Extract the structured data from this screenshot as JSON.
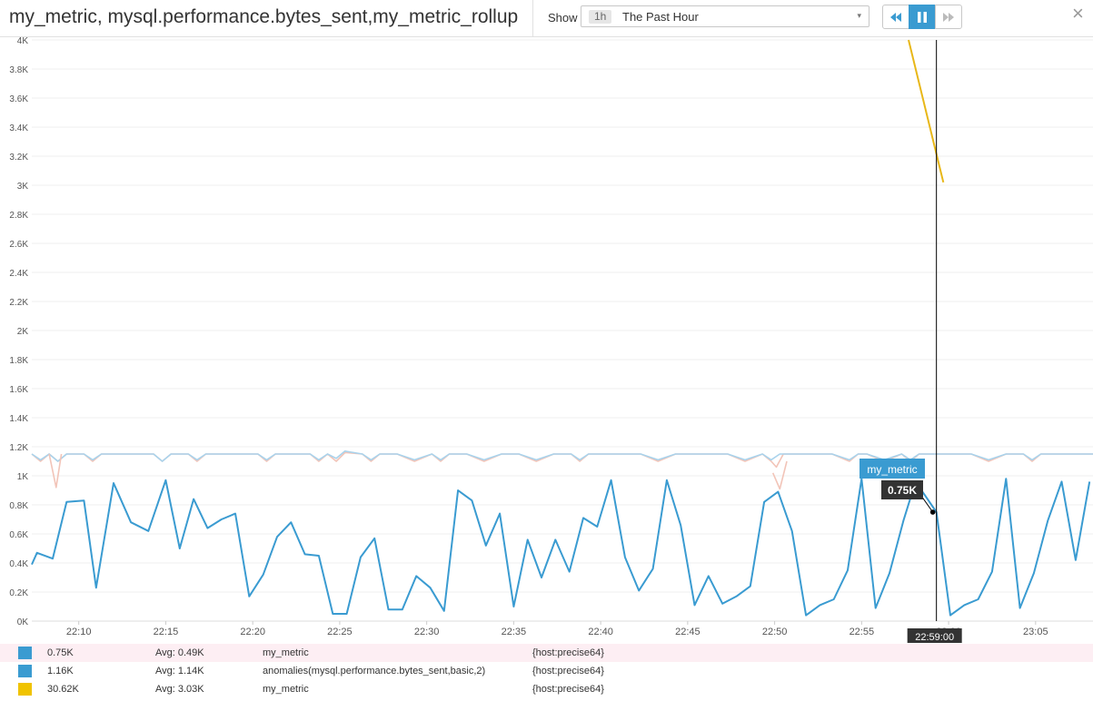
{
  "header": {
    "title": "my_metric, mysql.performance.bytes_sent,my_metric_rollup",
    "show_label": "Show",
    "timeframe_badge": "1h",
    "timeframe_value": "The Past Hour",
    "buttons": {
      "rewind_icon": "double-chevron-left-icon",
      "pause_icon": "pause-icon",
      "forward_icon": "double-chevron-right-icon"
    },
    "close_label": "×"
  },
  "tooltip": {
    "series_name": "my_metric",
    "value": "0.75K",
    "time": "22:59:00"
  },
  "legend": [
    {
      "color": "#3a9bd1",
      "current": "0.75K",
      "avg": "Avg: 0.49K",
      "name": "my_metric",
      "tags": "{host:precise64}",
      "highlighted": true
    },
    {
      "color": "#3a9bd1",
      "current": "1.16K",
      "avg": "Avg: 1.14K",
      "name": "anomalies(mysql.performance.bytes_sent,basic,2)",
      "tags": "{host:precise64}",
      "highlighted": false
    },
    {
      "color": "#f0c300",
      "current": "30.62K",
      "avg": "Avg: 3.03K",
      "name": "my_metric",
      "tags": "{host:precise64}",
      "highlighted": false
    }
  ],
  "chart_data": {
    "type": "line",
    "x_unit": "minutes",
    "x_range": [
      "22:07:00",
      "23:07:00"
    ],
    "xlim": [
      22.3,
      83.3
    ],
    "ylim": [
      0,
      4000
    ],
    "grid": true,
    "y_ticks": [
      {
        "v": 0,
        "label": "0K"
      },
      {
        "v": 200,
        "label": "0.2K"
      },
      {
        "v": 400,
        "label": "0.4K"
      },
      {
        "v": 600,
        "label": "0.6K"
      },
      {
        "v": 800,
        "label": "0.8K"
      },
      {
        "v": 1000,
        "label": "1K"
      },
      {
        "v": 1200,
        "label": "1.2K"
      },
      {
        "v": 1400,
        "label": "1.4K"
      },
      {
        "v": 1600,
        "label": "1.6K"
      },
      {
        "v": 1800,
        "label": "1.8K"
      },
      {
        "v": 2000,
        "label": "2K"
      },
      {
        "v": 2200,
        "label": "2.2K"
      },
      {
        "v": 2400,
        "label": "2.4K"
      },
      {
        "v": 2600,
        "label": "2.6K"
      },
      {
        "v": 2800,
        "label": "2.8K"
      },
      {
        "v": 3000,
        "label": "3K"
      },
      {
        "v": 3200,
        "label": "3.2K"
      },
      {
        "v": 3400,
        "label": "3.4K"
      },
      {
        "v": 3600,
        "label": "3.6K"
      },
      {
        "v": 3800,
        "label": "3.8K"
      },
      {
        "v": 4000,
        "label": "4K"
      }
    ],
    "x_ticks": [
      {
        "v": 25,
        "label": "22:10"
      },
      {
        "v": 30,
        "label": "22:15"
      },
      {
        "v": 35,
        "label": "22:20"
      },
      {
        "v": 40,
        "label": "22:25"
      },
      {
        "v": 45,
        "label": "22:30"
      },
      {
        "v": 50,
        "label": "22:35"
      },
      {
        "v": 55,
        "label": "22:40"
      },
      {
        "v": 60,
        "label": "22:45"
      },
      {
        "v": 65,
        "label": "22:50"
      },
      {
        "v": 70,
        "label": "22:55"
      },
      {
        "v": 75,
        "label": "23:00"
      },
      {
        "v": 80,
        "label": "23:05"
      }
    ],
    "cursor_x": 74.3,
    "series": [
      {
        "name": "anomalies(mysql.performance.bytes_sent,basic,2)",
        "color": "#f2c4b8",
        "style": "band_lower",
        "x": [
          22.3,
          22.8,
          23.3,
          23.8,
          24.3,
          25.3,
          25.8,
          26.3,
          27.3,
          28.3,
          29.3,
          29.8,
          30.3,
          31.3,
          31.8,
          32.3,
          33.3,
          34.3,
          35.3,
          35.8,
          36.3,
          37.3,
          38.3,
          38.8,
          39.3,
          39.8,
          40.3,
          41.3,
          41.8,
          42.3,
          43.3,
          44.3,
          45.3,
          45.8,
          46.3,
          47.3,
          48.3,
          49.3,
          50.3,
          51.3,
          52.3,
          53.3,
          53.8,
          54.3,
          55.3,
          56.3,
          57.3,
          58.3,
          59.3,
          60.3,
          61.3,
          62.3,
          63.3,
          64.3,
          64.8,
          65.1,
          65.5,
          66.3,
          67.3,
          68.3,
          69.3,
          69.8,
          70.3,
          71.3,
          72.3,
          72.8,
          73.3,
          74.3,
          75.3,
          76.3,
          77.3,
          78.3,
          79.3,
          79.8,
          80.3,
          81.3,
          82.3,
          83.3
        ],
        "values": [
          1150,
          1100,
          1150,
          1100,
          1150,
          1150,
          1100,
          1150,
          1150,
          1150,
          1150,
          1100,
          1150,
          1150,
          1100,
          1150,
          1150,
          1150,
          1150,
          1100,
          1150,
          1150,
          1150,
          1100,
          1150,
          1100,
          1160,
          1150,
          1100,
          1150,
          1150,
          1100,
          1150,
          1100,
          1150,
          1150,
          1100,
          1150,
          1150,
          1100,
          1150,
          1150,
          1100,
          1150,
          1150,
          1150,
          1150,
          1100,
          1150,
          1150,
          1150,
          1150,
          1100,
          1150,
          1100,
          1060,
          1150,
          1150,
          1150,
          1150,
          1100,
          1150,
          1150,
          1100,
          1150,
          1100,
          1150,
          1150,
          1150,
          1150,
          1100,
          1150,
          1150,
          1100,
          1150,
          1150,
          1150,
          1150
        ]
      },
      {
        "name": "anomalies(mysql.performance.bytes_sent,basic,2)",
        "color": "#a9d3ec",
        "style": "band_upper",
        "x": [
          22.3,
          22.8,
          23.3,
          23.8,
          24.3,
          25.3,
          25.8,
          26.3,
          27.3,
          28.3,
          29.3,
          29.8,
          30.3,
          31.3,
          31.8,
          32.3,
          33.3,
          34.3,
          35.3,
          35.8,
          36.3,
          37.3,
          38.3,
          38.8,
          39.3,
          39.8,
          40.3,
          41.3,
          41.8,
          42.3,
          43.3,
          44.3,
          45.3,
          45.8,
          46.3,
          47.3,
          48.3,
          49.3,
          50.3,
          51.3,
          52.3,
          53.3,
          53.8,
          54.3,
          55.3,
          56.3,
          57.3,
          58.3,
          59.3,
          60.3,
          61.3,
          62.3,
          63.3,
          64.3,
          64.8,
          65.3,
          66.3,
          67.3,
          68.3,
          69.3,
          69.8,
          70.3,
          71.3,
          72.3,
          72.8,
          73.3,
          74.3,
          75.3,
          76.3,
          77.3,
          78.3,
          79.3,
          79.8,
          80.3,
          81.3,
          82.3,
          83.3
        ],
        "values": [
          1150,
          1110,
          1150,
          1100,
          1150,
          1150,
          1110,
          1150,
          1150,
          1150,
          1150,
          1100,
          1150,
          1150,
          1110,
          1150,
          1150,
          1150,
          1150,
          1110,
          1150,
          1150,
          1150,
          1110,
          1150,
          1120,
          1170,
          1150,
          1110,
          1150,
          1150,
          1110,
          1150,
          1110,
          1150,
          1150,
          1110,
          1150,
          1150,
          1110,
          1150,
          1150,
          1110,
          1150,
          1150,
          1150,
          1150,
          1110,
          1150,
          1150,
          1150,
          1150,
          1110,
          1150,
          1110,
          1150,
          1150,
          1150,
          1150,
          1110,
          1150,
          1150,
          1110,
          1150,
          1110,
          1150,
          1150,
          1150,
          1150,
          1110,
          1150,
          1150,
          1110,
          1150,
          1150,
          1150,
          1150
        ]
      },
      {
        "name": "anomalies(mysql.performance.bytes_sent,basic,2)",
        "color": "#f2c4b8",
        "style": "band_dips",
        "x": [
          23.3,
          23.7,
          24.0
        ],
        "values": [
          1150,
          920,
          1150
        ]
      },
      {
        "name": "anomalies(mysql.performance.bytes_sent,basic,2)",
        "color": "#f2c4b8",
        "style": "band_dips",
        "x": [
          64.9,
          65.3,
          65.7
        ],
        "values": [
          1020,
          910,
          1100
        ]
      },
      {
        "name": "my_metric",
        "color": "#3a9bd1",
        "style": "main",
        "x": [
          22.3,
          22.6,
          23.5,
          24.3,
          25.3,
          26.0,
          27.0,
          28.0,
          29.0,
          30.0,
          30.8,
          31.6,
          32.4,
          33.2,
          34.0,
          34.8,
          35.6,
          36.4,
          37.2,
          38.0,
          38.8,
          39.6,
          40.4,
          41.2,
          42.0,
          42.8,
          43.6,
          44.4,
          45.2,
          46.0,
          46.8,
          47.6,
          48.4,
          49.2,
          50.0,
          50.8,
          51.6,
          52.4,
          53.2,
          54.0,
          54.8,
          55.6,
          56.4,
          57.2,
          58.0,
          58.8,
          59.6,
          60.4,
          61.2,
          62.0,
          62.8,
          63.6,
          64.4,
          65.2,
          66.0,
          66.8,
          67.6,
          68.4,
          69.2,
          70.0,
          70.8,
          71.6,
          72.4,
          73.1,
          74.3,
          75.1,
          75.9,
          76.7,
          77.5,
          78.3,
          79.1,
          79.9,
          80.7,
          81.5,
          82.3,
          83.1
        ],
        "values": [
          390,
          470,
          430,
          820,
          830,
          230,
          950,
          680,
          620,
          970,
          500,
          840,
          640,
          700,
          740,
          170,
          320,
          580,
          680,
          460,
          450,
          50,
          50,
          440,
          570,
          80,
          80,
          310,
          230,
          70,
          900,
          830,
          520,
          740,
          100,
          560,
          300,
          560,
          340,
          710,
          650,
          970,
          440,
          210,
          360,
          970,
          660,
          110,
          310,
          120,
          170,
          240,
          820,
          890,
          620,
          40,
          110,
          150,
          350,
          980,
          90,
          330,
          690,
          960,
          750,
          40,
          110,
          150,
          340,
          980,
          90,
          330,
          690,
          960,
          420,
          960
        ]
      },
      {
        "name": "my_metric",
        "color": "#e8b718",
        "style": "spike",
        "x": [
          72.7,
          74.7
        ],
        "values": [
          4000,
          3020
        ]
      }
    ]
  }
}
